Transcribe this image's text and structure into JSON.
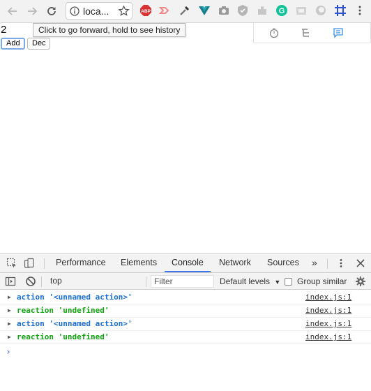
{
  "browser": {
    "url": "loca...",
    "extensions": [
      "adblock-plus-icon",
      "cast-icon",
      "eyedropper-icon",
      "vue-devtools-icon",
      "camera-icon",
      "shield-icon",
      "puzzle-icon",
      "grammarly-icon",
      "tab-icon",
      "circle-icon",
      "grid-icon"
    ],
    "extension_labels": {
      "abp": "ABP",
      "grammarly": "G"
    }
  },
  "page": {
    "counter_value": "2",
    "add_label": "Add",
    "dec_label": "Dec",
    "tooltip": "Click to go forward, hold to see history"
  },
  "devtools": {
    "tabs": [
      "Performance",
      "Elements",
      "Console",
      "Network",
      "Sources"
    ],
    "active_tab": "Console",
    "more_tabs": "»",
    "context": "top",
    "filter_placeholder": "Filter",
    "levels": "Default levels",
    "group_similar": "Group similar",
    "logs": [
      {
        "text": "action '<unnamed action>'",
        "color": "#1a6fd6",
        "source": "index.js:1"
      },
      {
        "text": "reaction 'undefined'",
        "color": "#11a311",
        "source": "index.js:1"
      },
      {
        "text": "action '<unnamed action>'",
        "color": "#1a6fd6",
        "source": "index.js:1"
      },
      {
        "text": "reaction 'undefined'",
        "color": "#11a311",
        "source": "index.js:1"
      }
    ],
    "prompt": "›"
  }
}
